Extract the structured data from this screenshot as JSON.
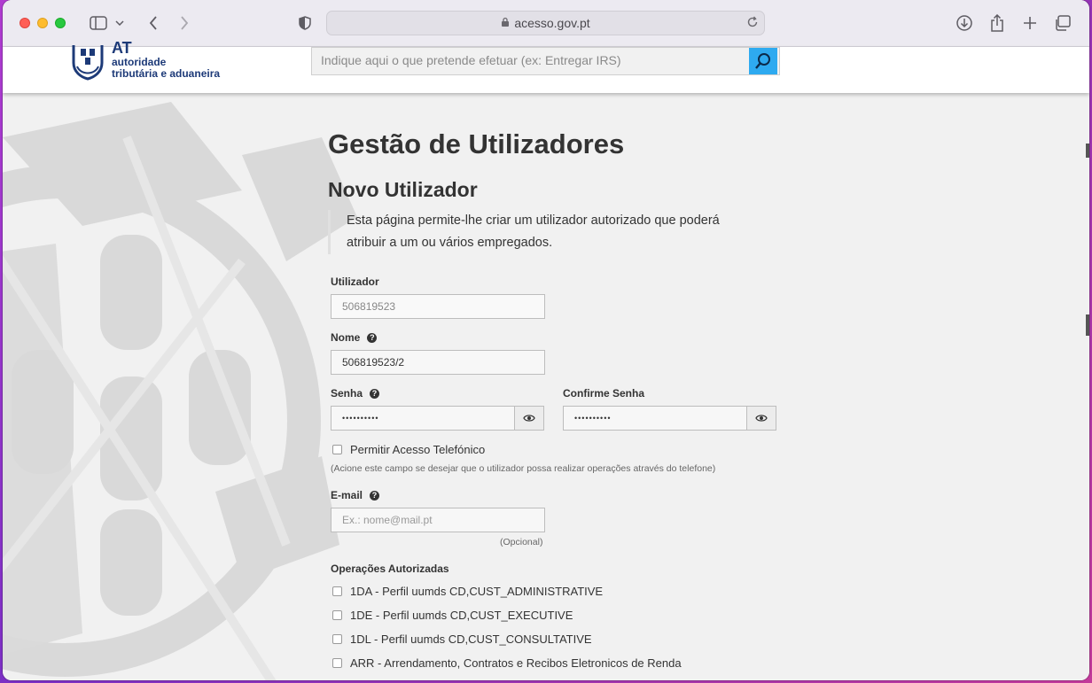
{
  "browser": {
    "address": "acesso.gov.pt"
  },
  "site": {
    "logo_at": "AT",
    "logo_line1": "autoridade",
    "logo_line2": "tributária e aduaneira",
    "search_placeholder": "Indique aqui o que pretende efetuar (ex: Entregar IRS)"
  },
  "page": {
    "title": "Gestão de Utilizadores",
    "subtitle": "Novo Utilizador",
    "intro": "Esta página permite-lhe criar um utilizador autorizado que poderá atribuir a um ou vários empregados."
  },
  "form": {
    "utilizador_label": "Utilizador",
    "utilizador_value": "506819523",
    "nome_label": "Nome",
    "nome_value": "506819523/2",
    "senha_label": "Senha",
    "senha_value": "••••••••••",
    "confirme_label": "Confirme Senha",
    "confirme_value": "••••••••••",
    "telefonico_label": "Permitir Acesso Telefónico",
    "telefonico_hint": "(Acione este campo se desejar que o utilizador possa realizar operações através do telefone)",
    "email_label": "E-mail",
    "email_placeholder": "Ex.: nome@mail.pt",
    "email_optional": "(Opcional)",
    "operacoes_label": "Operações Autorizadas",
    "operacoes": [
      "1DA - Perfil uumds CD,CUST_ADMINISTRATIVE",
      "1DE - Perfil uumds CD,CUST_EXECUTIVE",
      "1DL - Perfil uumds CD,CUST_CONSULTATIVE",
      "ARR - Arrendamento, Contratos e Recibos Eletronicos de Renda"
    ]
  }
}
